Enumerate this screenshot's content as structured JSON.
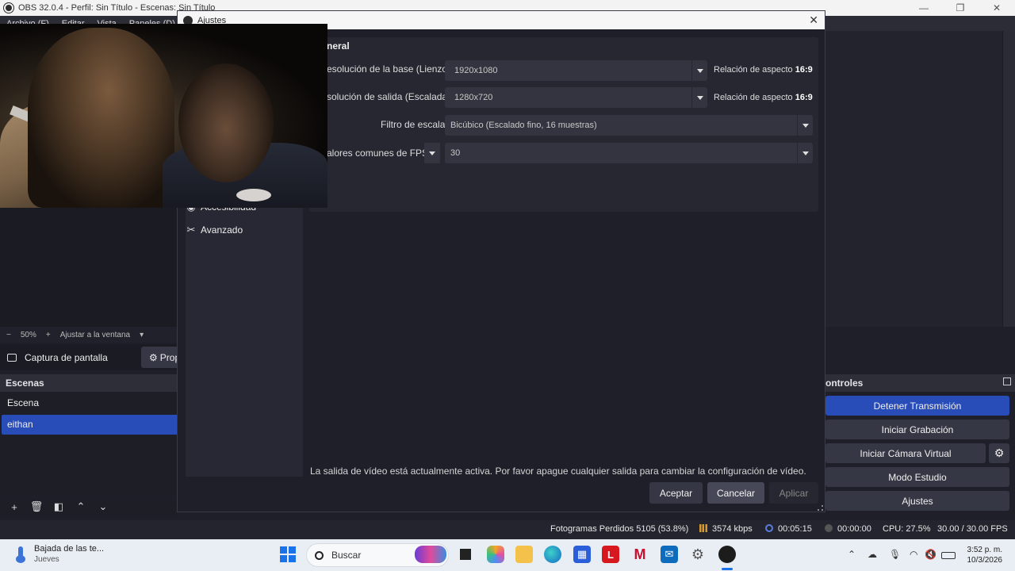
{
  "obs_window": {
    "title": "OBS 32.0.4 - Perfil: Sin Título - Escenas: Sin Título",
    "menu": [
      "Archivo (F)",
      "Editar",
      "Vista",
      "Paneles (D)"
    ]
  },
  "zoom_bar": {
    "minus": "−",
    "zoom": "50%",
    "plus": "+",
    "fit": "Ajustar a la ventana"
  },
  "source_bar": {
    "label": "Captura de pantalla",
    "props_label": "Prop"
  },
  "scenes": {
    "header": "Escenas",
    "items": [
      {
        "label": "Escena"
      },
      {
        "label": "eithan"
      }
    ],
    "selected": "eithan"
  },
  "controls": {
    "header": "ontroles",
    "buttons": {
      "stop_stream": "Detener Transmisión",
      "start_recording": "Iniciar Grabación",
      "virtual_cam": "Iniciar Cámara Virtual",
      "studio_mode": "Modo Estudio",
      "settings": "Ajustes"
    }
  },
  "statusbar": {
    "dropped_frames": "Fotogramas Perdidos 5105 (53.8%)",
    "bitrate": "3574 kbps",
    "stream_time": "00:05:15",
    "rec_time": "00:00:00",
    "cpu": "CPU: 27.5%",
    "fps": "30.00 / 30.00 FPS"
  },
  "settings_dialog": {
    "title": "Ajustes",
    "section_title": "neral",
    "sidebar": {
      "partial_item": "Accesibilidad",
      "advanced": "Avanzado"
    },
    "fields": {
      "base_resolution_label": "esolución de la base (Lienzo)",
      "base_resolution_value": "1920x1080",
      "base_aspect_prefix": "Relación de aspecto",
      "base_aspect_value": "16:9",
      "output_resolution_label": "solución de salida (Escalada)",
      "output_resolution_value": "1280x720",
      "output_aspect_prefix": "Relación de aspecto",
      "output_aspect_value": "16:9",
      "filter_label": "Filtro de escala",
      "filter_value": "Bicúbico (Escalado fino, 16 muestras)",
      "fps_type_label": "alores comunes de FPS",
      "fps_value": "30"
    },
    "warning": "La salida de vídeo está actualmente activa. Por favor apague cualquier salida para cambiar la configuración de vídeo.",
    "buttons": {
      "ok": "Aceptar",
      "cancel": "Cancelar",
      "apply": "Aplicar"
    }
  },
  "taskbar": {
    "weather_title": "Bajada de las te...",
    "weather_sub": "Jueves",
    "search_placeholder": "Buscar",
    "time": "3:52 p. m.",
    "date": "10/3/2026"
  },
  "colors": {
    "accent_blue": "#284cb8",
    "dialog_bg": "#1e1f29",
    "panel_bg": "#262731"
  }
}
